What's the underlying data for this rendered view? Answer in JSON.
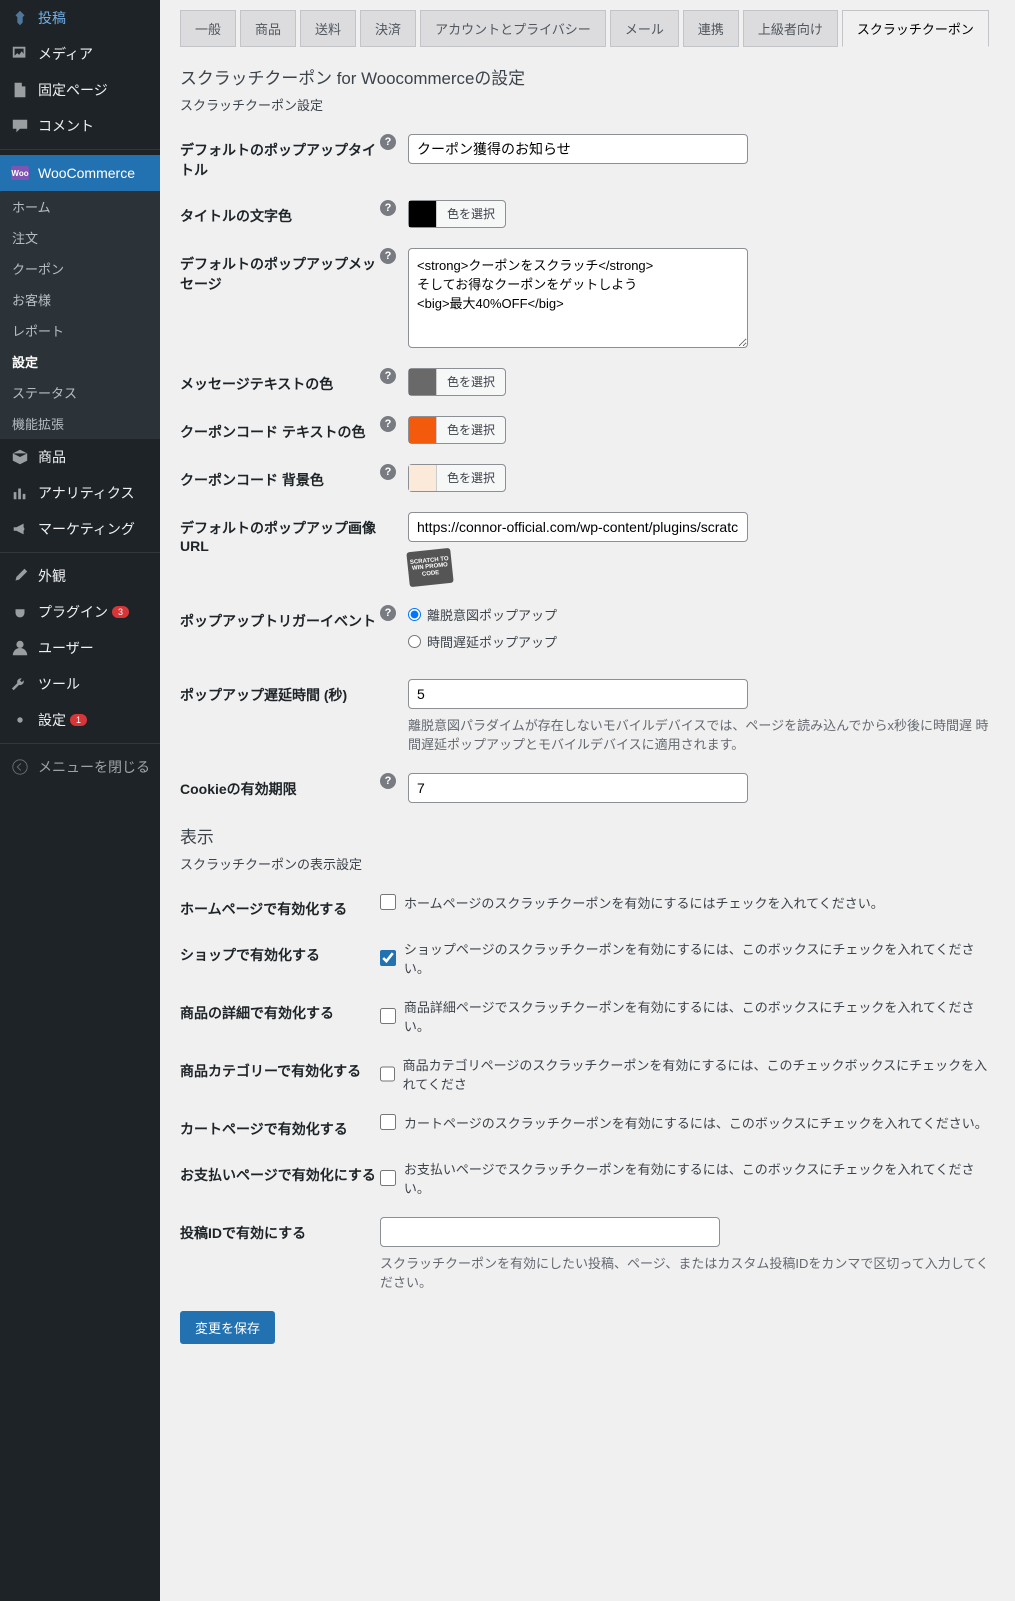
{
  "sidebar": {
    "items": [
      {
        "id": "posts",
        "label": "投稿",
        "icon": "pin"
      },
      {
        "id": "media",
        "label": "メディア",
        "icon": "media"
      },
      {
        "id": "pages",
        "label": "固定ページ",
        "icon": "page"
      },
      {
        "id": "comments",
        "label": "コメント",
        "icon": "comment"
      }
    ],
    "woo": {
      "label": "WooCommerce"
    },
    "woo_sub": [
      {
        "id": "home",
        "label": "ホーム"
      },
      {
        "id": "orders",
        "label": "注文"
      },
      {
        "id": "coupons",
        "label": "クーポン"
      },
      {
        "id": "customers",
        "label": "お客様"
      },
      {
        "id": "reports",
        "label": "レポート"
      },
      {
        "id": "settings",
        "label": "設定",
        "active": true
      },
      {
        "id": "status",
        "label": "ステータス"
      },
      {
        "id": "extensions",
        "label": "機能拡張"
      }
    ],
    "items2": [
      {
        "id": "products",
        "label": "商品",
        "icon": "box"
      },
      {
        "id": "analytics",
        "label": "アナリティクス",
        "icon": "chart"
      },
      {
        "id": "marketing",
        "label": "マーケティング",
        "icon": "mega"
      }
    ],
    "items3": [
      {
        "id": "appearance",
        "label": "外観",
        "icon": "brush"
      },
      {
        "id": "plugins",
        "label": "プラグイン",
        "icon": "plug",
        "badge": "3"
      },
      {
        "id": "users",
        "label": "ユーザー",
        "icon": "user"
      },
      {
        "id": "tools",
        "label": "ツール",
        "icon": "tool"
      },
      {
        "id": "settings",
        "label": "設定",
        "icon": "gear",
        "badge": "1"
      }
    ],
    "collapse": "メニューを閉じる"
  },
  "tabs": [
    {
      "id": "general",
      "label": "一般"
    },
    {
      "id": "products",
      "label": "商品"
    },
    {
      "id": "shipping",
      "label": "送料"
    },
    {
      "id": "payments",
      "label": "決済"
    },
    {
      "id": "accounts",
      "label": "アカウントとプライバシー"
    },
    {
      "id": "emails",
      "label": "メール"
    },
    {
      "id": "integration",
      "label": "連携"
    },
    {
      "id": "advanced",
      "label": "上級者向け"
    },
    {
      "id": "scratch",
      "label": "スクラッチクーポン",
      "active": true
    }
  ],
  "section1": {
    "title": "スクラッチクーポン for Woocommerceの設定",
    "desc": "スクラッチクーポン設定"
  },
  "fields": {
    "popup_title": {
      "label": "デフォルトのポップアップタイトル",
      "value": "クーポン獲得のお知らせ"
    },
    "title_color": {
      "label": "タイトルの文字色",
      "btn": "色を選択",
      "swatch": "#000000"
    },
    "popup_msg": {
      "label": "デフォルトのポップアップメッセージ",
      "value": "<strong>クーポンをスクラッチ</strong>\nそしてお得なクーポンをゲットしよう\n<big>最大40%OFF</big>"
    },
    "msg_color": {
      "label": "メッセージテキストの色",
      "btn": "色を選択",
      "swatch": "#696969"
    },
    "coupon_text_color": {
      "label": "クーポンコード テキストの色",
      "btn": "色を選択",
      "swatch": "#f35a0c"
    },
    "coupon_bg_color": {
      "label": "クーポンコード 背景色",
      "btn": "色を選択",
      "swatch": "#fbe9d9"
    },
    "popup_image": {
      "label": "デフォルトのポップアップ画像 URL",
      "value": "https://connor-official.com/wp-content/plugins/scratch-coupo",
      "thumb": "SCRATCH TO WIN PROMO CODE"
    },
    "trigger": {
      "label": "ポップアップトリガーイベント",
      "opt1": "離脱意図ポップアップ",
      "opt2": "時間遅延ポップアップ"
    },
    "delay": {
      "label": "ポップアップ遅延時間 (秒)",
      "value": "5",
      "help": "離脱意図パラダイムが存在しないモバイルデバイスでは、ページを読み込んでからx秒後に時間遅 時間遅延ポップアップとモバイルデバイスに適用されます。"
    },
    "cookie": {
      "label": "Cookieの有効期限",
      "value": "7"
    }
  },
  "section2": {
    "title": "表示",
    "desc": "スクラッチクーポンの表示設定"
  },
  "display_fields": {
    "home": {
      "label": "ホームページで有効化する",
      "desc": "ホームページのスクラッチクーポンを有効にするにはチェックを入れてください。",
      "checked": false
    },
    "shop": {
      "label": "ショップで有効化する",
      "desc": "ショップページのスクラッチクーポンを有効にするには、このボックスにチェックを入れてください。",
      "checked": true
    },
    "product": {
      "label": "商品の詳細で有効化する",
      "desc": "商品詳細ページでスクラッチクーポンを有効にするには、このボックスにチェックを入れてください。",
      "checked": false
    },
    "category": {
      "label": "商品カテゴリーで有効化する",
      "desc": "商品カテゴリページのスクラッチクーポンを有効にするには、このチェックボックスにチェックを入れてくださ",
      "checked": false
    },
    "cart": {
      "label": "カートページで有効化する",
      "desc": "カートページのスクラッチクーポンを有効にするには、このボックスにチェックを入れてください。",
      "checked": false
    },
    "checkout": {
      "label": "お支払いページで有効化にする",
      "desc": "お支払いページでスクラッチクーポンを有効にするには、このボックスにチェックを入れてください。",
      "checked": false
    },
    "post_ids": {
      "label": "投稿IDで有効にする",
      "help": "スクラッチクーポンを有効にしたい投稿、ページ、またはカスタム投稿IDをカンマで区切って入力してください。",
      "value": ""
    }
  },
  "submit": "変更を保存"
}
